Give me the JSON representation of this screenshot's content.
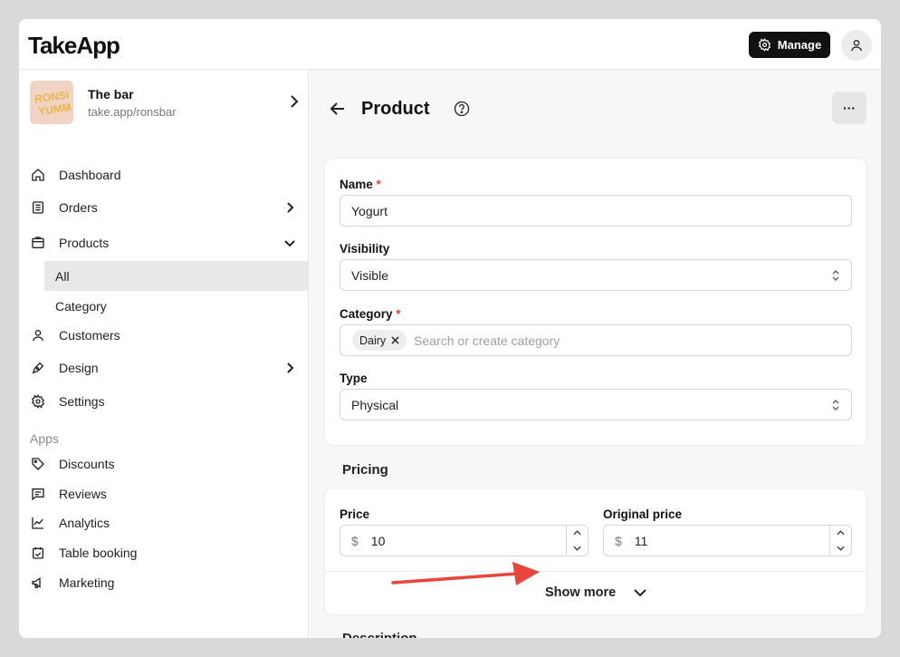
{
  "app": {
    "logo": "TakeApp",
    "manage_label": "Manage"
  },
  "store": {
    "name": "The bar",
    "url": "take.app/ronsbar",
    "logo_text": "RONSI YUMM"
  },
  "sidebar": {
    "items": [
      {
        "label": "Dashboard",
        "icon": "home-icon"
      },
      {
        "label": "Orders",
        "icon": "orders-icon"
      },
      {
        "label": "Products",
        "icon": "products-icon"
      },
      {
        "label": "Customers",
        "icon": "user-icon"
      },
      {
        "label": "Design",
        "icon": "pen-icon"
      },
      {
        "label": "Settings",
        "icon": "gear-icon"
      }
    ],
    "products_sub": [
      "All",
      "Category"
    ],
    "apps_label": "Apps",
    "apps": [
      {
        "label": "Discounts",
        "icon": "tag-icon"
      },
      {
        "label": "Reviews",
        "icon": "review-icon"
      },
      {
        "label": "Analytics",
        "icon": "chart-icon"
      },
      {
        "label": "Table booking",
        "icon": "calendar-icon"
      },
      {
        "label": "Marketing",
        "icon": "megaphone-icon"
      }
    ]
  },
  "page": {
    "title": "Product",
    "more_label": "···"
  },
  "form": {
    "name": {
      "label": "Name",
      "required_mark": "*",
      "value": "Yogurt"
    },
    "visibility": {
      "label": "Visibility",
      "value": "Visible"
    },
    "category": {
      "label": "Category",
      "required_mark": "*",
      "chip": "Dairy",
      "placeholder": "Search or create category"
    },
    "type": {
      "label": "Type",
      "value": "Physical"
    }
  },
  "pricing": {
    "title": "Pricing",
    "price": {
      "label": "Price",
      "currency": "$",
      "value": "10"
    },
    "original_price": {
      "label": "Original price",
      "currency": "$",
      "value": "11"
    },
    "show_more": "Show more"
  },
  "description": {
    "title": "Description"
  },
  "colors": {
    "accent_dark": "#111111",
    "required": "#e0413a",
    "annotation_arrow": "#e8463c"
  }
}
